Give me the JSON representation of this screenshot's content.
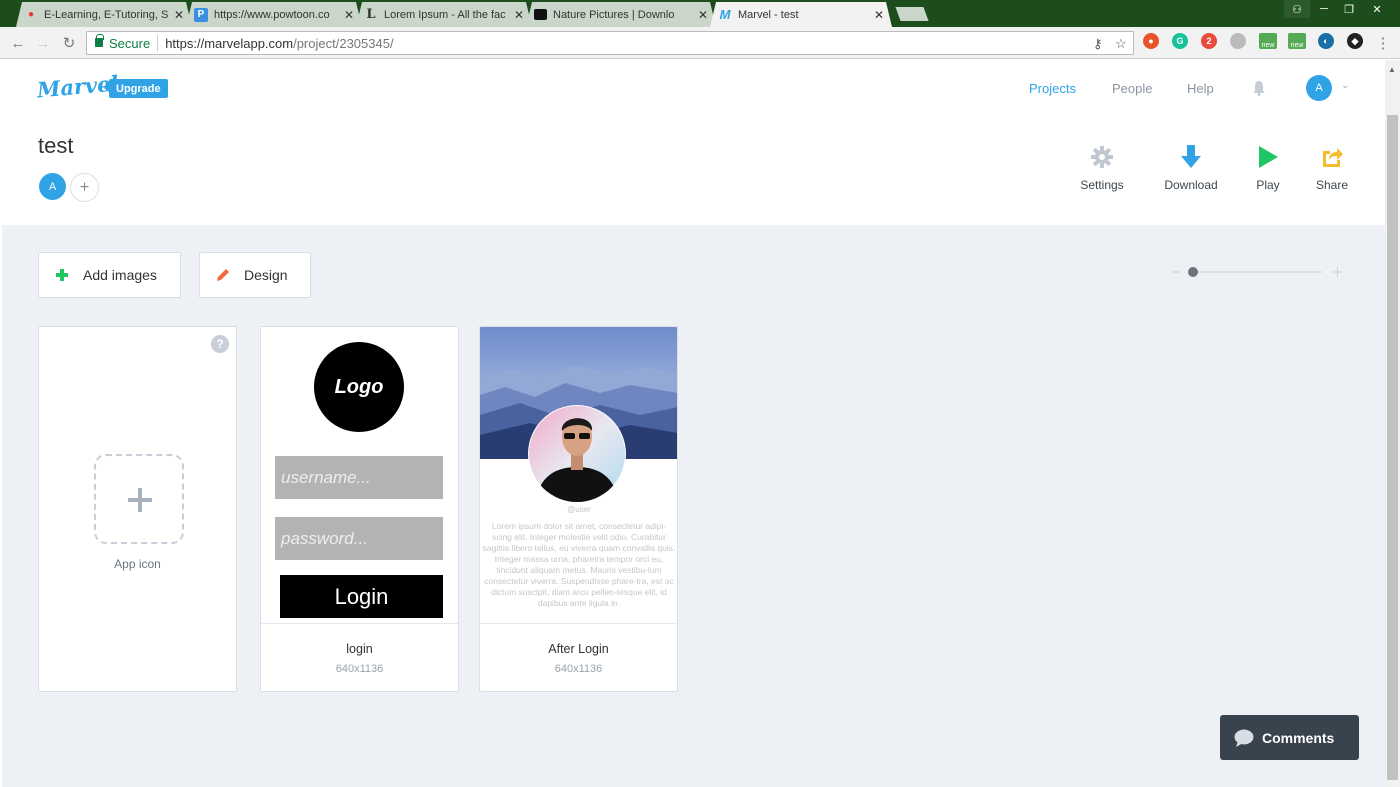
{
  "browser": {
    "tabs": [
      {
        "title": "E-Learning, E-Tutoring, S",
        "icon": "elearning-favicon"
      },
      {
        "title": "https://www.powtoon.co",
        "icon": "powtoon-favicon"
      },
      {
        "title": "Lorem Ipsum - All the fac",
        "icon": "lorem-favicon"
      },
      {
        "title": "Nature Pictures | Downlo",
        "icon": "camera-favicon"
      },
      {
        "title": "Marvel - test",
        "icon": "marvel-favicon"
      }
    ],
    "secure_label": "Secure",
    "url_host": "https://marvelapp.com",
    "url_path": "/project/2305345/",
    "ext_new1": "new",
    "ext_new2": "new",
    "ext_badge": "2"
  },
  "header": {
    "logo": "Marvel",
    "upgrade": "Upgrade",
    "nav": {
      "projects": "Projects",
      "people": "People",
      "help": "Help"
    },
    "avatar_initial": "A"
  },
  "project": {
    "title": "test",
    "member_initial": "A",
    "add_member": "+",
    "actions": {
      "settings": "Settings",
      "download": "Download",
      "play": "Play",
      "share": "Share"
    }
  },
  "toolbar": {
    "add_images": "Add images",
    "design": "Design"
  },
  "cards": {
    "app_icon": {
      "label": "App icon"
    },
    "screens": [
      {
        "name": "login",
        "size": "640x1136",
        "logo_text": "Logo",
        "username_ph": "username...",
        "password_ph": "password...",
        "button": "Login"
      },
      {
        "name": "After Login",
        "size": "640x1136",
        "handle": "@user",
        "bio": "Lorem ipsum dolor sit amet, consectetur adipi-scing elit. Integer molestie velit odio. Curabitur sagittis libero tellus, eu viverra quam convallis quis. Integer massa urna, pharetra tempor orci eu, tincidunt aliquam metus. Mauris vestibu-lum consectetur viverra. Suspendisse phare-tra, est ac dictum suscipit, diam arcu pellen-tesque elit, id dapibus ante ligula in."
      }
    ]
  },
  "comments": {
    "label": "Comments"
  },
  "colors": {
    "accent": "#2fa3e5",
    "play": "#1fc764",
    "share": "#f5bd2b",
    "add": "#1fc764",
    "design": "#ef6b3f"
  }
}
